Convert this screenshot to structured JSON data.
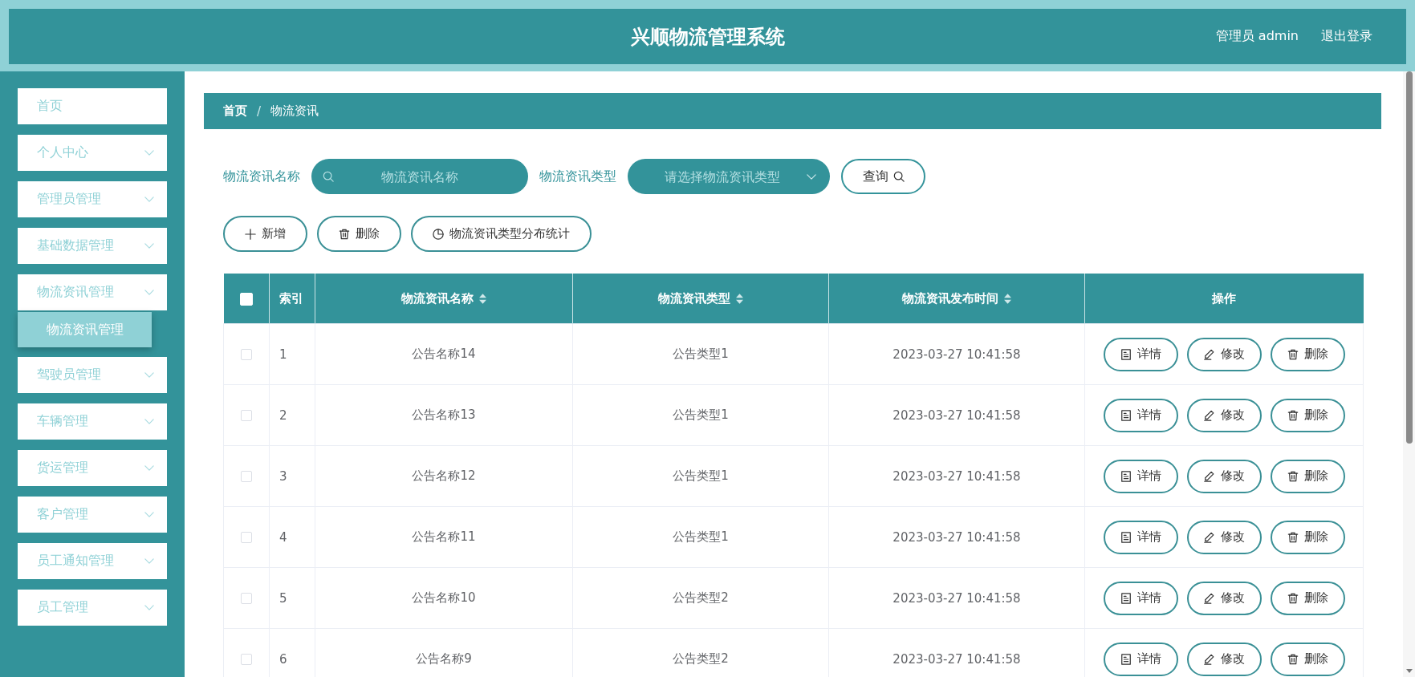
{
  "header": {
    "title": "兴顺物流管理系统",
    "user": "管理员 admin",
    "logout": "退出登录"
  },
  "sidebar": {
    "items": [
      {
        "label": "首页",
        "kind": "link",
        "selected": false
      },
      {
        "label": "个人中心",
        "kind": "submenu",
        "selected": false
      },
      {
        "label": "管理员管理",
        "kind": "submenu",
        "selected": false
      },
      {
        "label": "基础数据管理",
        "kind": "submenu",
        "selected": false
      },
      {
        "label": "物流资讯管理",
        "kind": "submenu",
        "selected": false,
        "children": [
          {
            "label": "物流资讯管理",
            "selected": true
          }
        ]
      },
      {
        "label": "驾驶员管理",
        "kind": "submenu",
        "selected": false
      },
      {
        "label": "车辆管理",
        "kind": "submenu",
        "selected": false
      },
      {
        "label": "货运管理",
        "kind": "submenu",
        "selected": false
      },
      {
        "label": "客户管理",
        "kind": "submenu",
        "selected": false
      },
      {
        "label": "员工通知管理",
        "kind": "submenu",
        "selected": false
      },
      {
        "label": "员工管理",
        "kind": "submenu",
        "selected": false
      }
    ]
  },
  "breadcrumb": {
    "items": [
      "首页",
      "物流资讯"
    ],
    "separator": "/"
  },
  "search": {
    "fields": [
      {
        "label": "物流资讯名称",
        "kind": "input",
        "placeholder": "物流资讯名称"
      },
      {
        "label": "物流资讯类型",
        "kind": "select",
        "placeholder": "请选择物流资讯类型"
      }
    ],
    "button": "查询"
  },
  "actions": [
    {
      "label": "新增",
      "kind": "add"
    },
    {
      "label": "删除",
      "kind": "delete"
    },
    {
      "label": "物流资讯类型分布统计",
      "kind": "chart"
    }
  ],
  "table": {
    "select_all": {
      "checked": false
    },
    "columns": [
      {
        "label": "索引",
        "sortable": false
      },
      {
        "label": "物流资讯名称",
        "sortable": true
      },
      {
        "label": "物流资讯类型",
        "sortable": true
      },
      {
        "label": "物流资讯发布时间",
        "sortable": true
      },
      {
        "label": "操作",
        "sortable": false
      }
    ],
    "rows": [
      {
        "selected": false,
        "cells": [
          "1",
          "公告名称14",
          "公告类型1",
          "2023-03-27 10:41:58"
        ],
        "actions": [
          {
            "label": "详情",
            "kind": "detail"
          },
          {
            "label": "修改",
            "kind": "edit"
          },
          {
            "label": "删除",
            "kind": "delete"
          }
        ]
      },
      {
        "selected": false,
        "cells": [
          "2",
          "公告名称13",
          "公告类型1",
          "2023-03-27 10:41:58"
        ],
        "actions": [
          {
            "label": "详情",
            "kind": "detail"
          },
          {
            "label": "修改",
            "kind": "edit"
          },
          {
            "label": "删除",
            "kind": "delete"
          }
        ]
      },
      {
        "selected": false,
        "cells": [
          "3",
          "公告名称12",
          "公告类型1",
          "2023-03-27 10:41:58"
        ],
        "actions": [
          {
            "label": "详情",
            "kind": "detail"
          },
          {
            "label": "修改",
            "kind": "edit"
          },
          {
            "label": "删除",
            "kind": "delete"
          }
        ]
      },
      {
        "selected": false,
        "cells": [
          "4",
          "公告名称11",
          "公告类型1",
          "2023-03-27 10:41:58"
        ],
        "actions": [
          {
            "label": "详情",
            "kind": "detail"
          },
          {
            "label": "修改",
            "kind": "edit"
          },
          {
            "label": "删除",
            "kind": "delete"
          }
        ]
      },
      {
        "selected": false,
        "cells": [
          "5",
          "公告名称10",
          "公告类型2",
          "2023-03-27 10:41:58"
        ],
        "actions": [
          {
            "label": "详情",
            "kind": "detail"
          },
          {
            "label": "修改",
            "kind": "edit"
          },
          {
            "label": "删除",
            "kind": "delete"
          }
        ]
      },
      {
        "selected": false,
        "cells": [
          "6",
          "公告名称9",
          "公告类型2",
          "2023-03-27 10:41:58"
        ],
        "actions": [
          {
            "label": "详情",
            "kind": "detail"
          },
          {
            "label": "修改",
            "kind": "edit"
          },
          {
            "label": "删除",
            "kind": "delete"
          }
        ]
      }
    ]
  }
}
